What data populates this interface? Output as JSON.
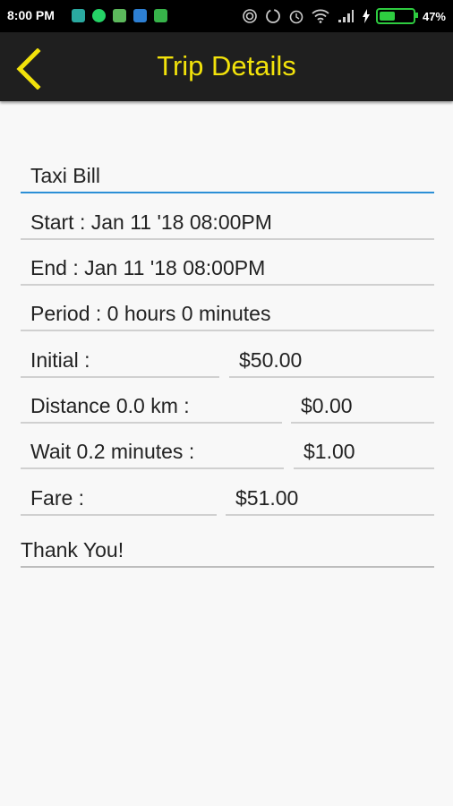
{
  "status_bar": {
    "time": "8:00 PM",
    "battery_percent": "47%",
    "battery_level": 0.47,
    "app_icons": [
      {
        "name": "gallery-icon",
        "color": "#2aa9a0"
      },
      {
        "name": "whatsapp-icon",
        "color": "#25d366"
      },
      {
        "name": "android-icon",
        "color": "#5cb85c"
      },
      {
        "name": "cloud-icon",
        "color": "#2d7fd3"
      },
      {
        "name": "clipboard-icon",
        "color": "#37b34a"
      }
    ]
  },
  "toolbar": {
    "title": "Trip Details",
    "accent_color": "#f2e20b"
  },
  "form": {
    "bill_title": "Taxi Bill",
    "start": "Start  : Jan 11 '18 08:00PM",
    "end": "End    : Jan 11 '18 08:00PM",
    "period": "Period : 0 hours 0 minutes",
    "initial_label": "Initial :",
    "initial_value": "$50.00",
    "distance_label": "Distance 0.0 km :",
    "distance_value": "$0.00",
    "wait_label": "Wait 0.2 minutes :",
    "wait_value": "$1.00",
    "fare_label": "Fare :",
    "fare_value": "$51.00",
    "note": "Thank You!"
  }
}
